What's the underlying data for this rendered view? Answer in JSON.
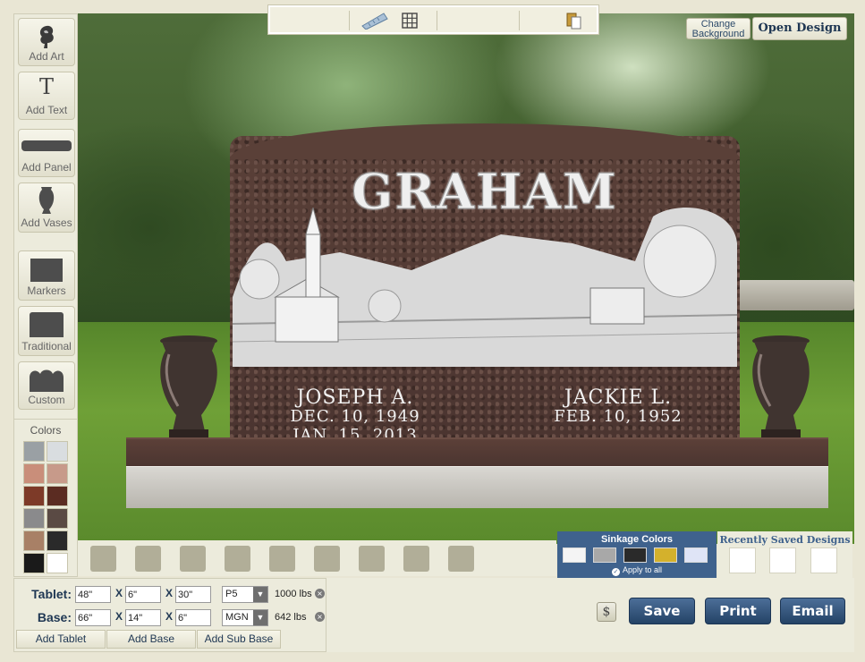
{
  "left_toolbar": {
    "tools": [
      {
        "label": "Add Art",
        "icon": "rose-art-icon"
      },
      {
        "label": "Add Text",
        "icon": "text-t-icon"
      },
      {
        "label": "Add Panel",
        "icon": "panel-icon"
      },
      {
        "label": "Add Vases",
        "icon": "vase-icon"
      },
      {
        "label": "Markers",
        "icon": "marker-icon"
      },
      {
        "label": "Traditional",
        "icon": "traditional-icon"
      },
      {
        "label": "Custom",
        "icon": "custom-shape-icon"
      }
    ],
    "colors_title": "Colors",
    "granite_swatches": [
      "#9aa0a4",
      "#d9dde0",
      "#c98e7a",
      "#c79a8a",
      "#7d3a28",
      "#5b2c22",
      "#8a8a8c",
      "#5a4a44",
      "#a88066",
      "#2a2a2a",
      "#1a1a1a",
      "#ffffff"
    ]
  },
  "top_toolbar": {
    "icons": [
      "ruler-icon",
      "grid-icon",
      "paste-icon"
    ]
  },
  "header": {
    "change_background": "Change Background",
    "open_design": "Open Design"
  },
  "monument": {
    "family_name": "GRAHAM",
    "left_name": "JOSEPH A.",
    "left_date_1": "DEC. 10, 1949",
    "left_date_2": "JAN. 15, 2013",
    "right_name": "JACKIE L.",
    "right_date_1": "FEB. 10, 1952"
  },
  "sinkage": {
    "title": "Sinkage Colors",
    "apply_all": "Apply to all",
    "colors": [
      "#f4f4f4",
      "#a8a8a8",
      "#2a2a2a",
      "#d4b12c",
      "#dfe4f6"
    ]
  },
  "recent": {
    "title": "Recently Saved Designs"
  },
  "dimensions": {
    "tablet": {
      "label": "Tablet:",
      "w": "48\"",
      "d": "6\"",
      "h": "30\"",
      "finish": "P5",
      "weight": "1000 lbs"
    },
    "base": {
      "label": "Base:",
      "w": "66\"",
      "d": "14\"",
      "h": "6\"",
      "finish": "MGN",
      "weight": "642 lbs"
    },
    "sep": "X",
    "remove": "×",
    "add_tablet": "Add Tablet",
    "add_base": "Add Base",
    "add_sub_base": "Add Sub Base"
  },
  "actions": {
    "price": "$",
    "save": "Save",
    "print": "Print",
    "email": "Email"
  }
}
